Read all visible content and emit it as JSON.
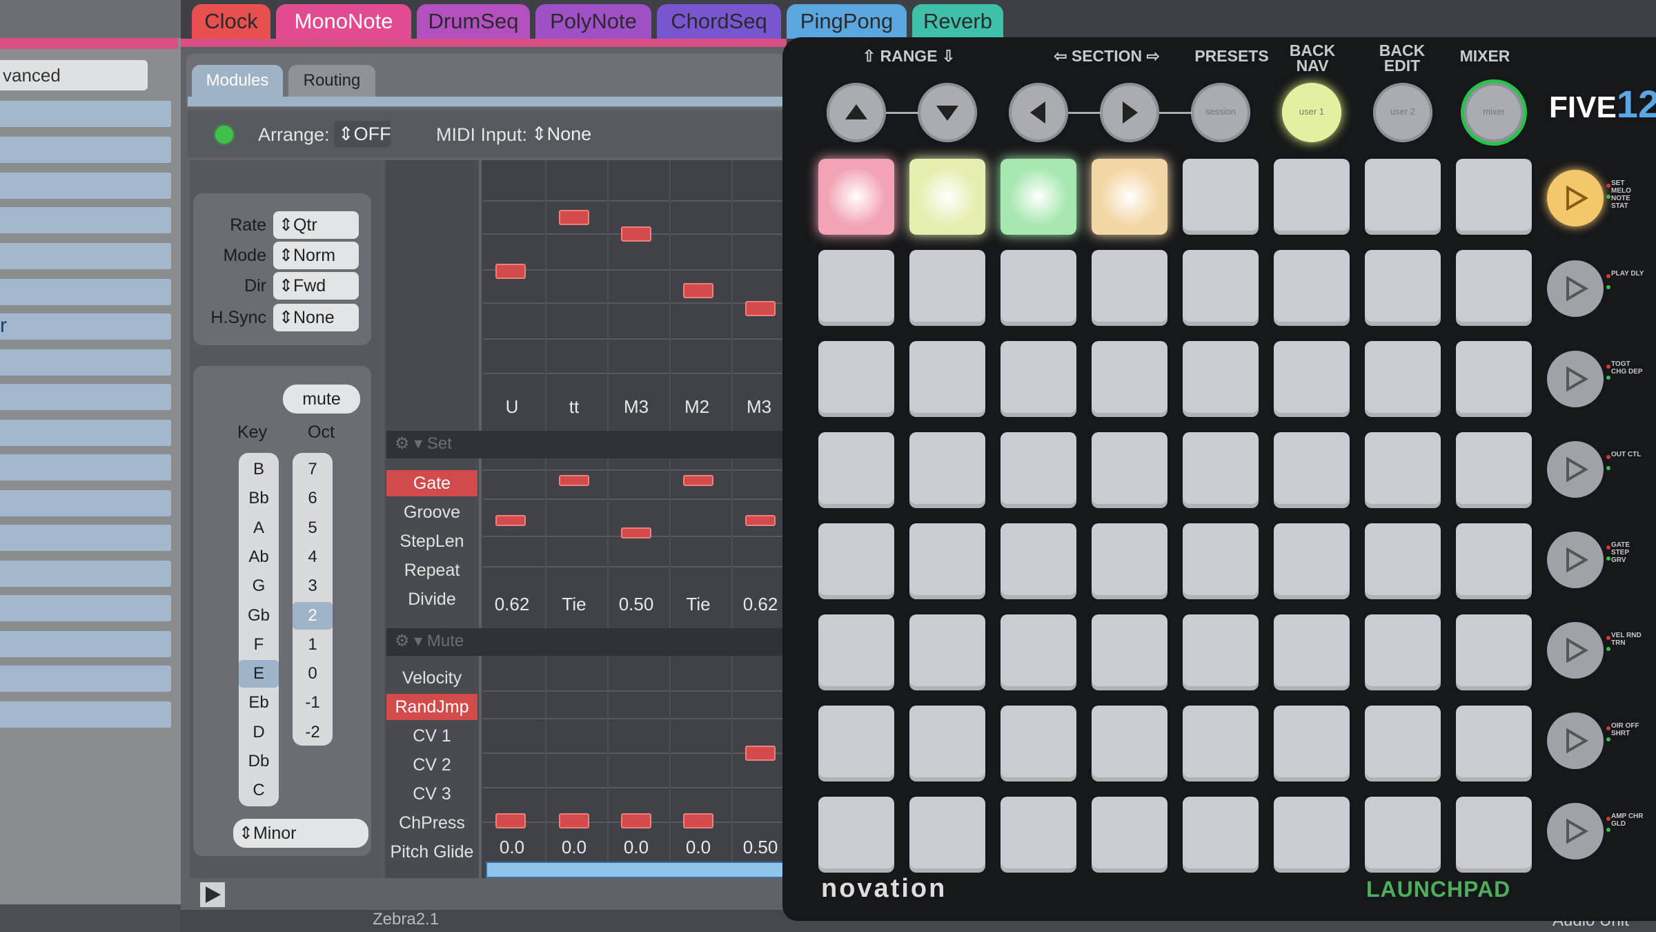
{
  "left_panel": {
    "search_value": "vanced",
    "row_text": "r"
  },
  "tabs": [
    {
      "label": "Clock",
      "color": "#e85050"
    },
    {
      "label": "MonoNote",
      "color": "#e24b8f"
    },
    {
      "label": "DrumSeq",
      "color": "#b44fc0"
    },
    {
      "label": "PolyNote",
      "color": "#a050c6"
    },
    {
      "label": "ChordSeq",
      "color": "#7856d0"
    },
    {
      "label": "PingPong",
      "color": "#5aa7e0"
    },
    {
      "label": "Reverb",
      "color": "#3fc0a8"
    }
  ],
  "subtabs": {
    "modules": "Modules",
    "routing": "Routing"
  },
  "header": {
    "arrange_label": "Arrange:",
    "arrange_value": "⇕OFF",
    "midi_label": "MIDI Input:",
    "midi_value": "⇕None"
  },
  "params": [
    {
      "label": "Rate",
      "value": "⇕Qtr"
    },
    {
      "label": "Mode",
      "value": "⇕Norm"
    },
    {
      "label": "Dir",
      "value": "⇕Fwd"
    },
    {
      "label": "H.Sync",
      "value": "⇕None"
    }
  ],
  "mute_label": "mute",
  "key_header": "Key",
  "oct_header": "Oct",
  "keys": [
    "B",
    "Bb",
    "A",
    "Ab",
    "G",
    "Gb",
    "F",
    "E",
    "Eb",
    "D",
    "Db",
    "C"
  ],
  "selected_key": "E",
  "octaves": [
    "7",
    "6",
    "5",
    "4",
    "3",
    "2",
    "1",
    "0",
    "-1",
    "-2"
  ],
  "selected_octave": "2",
  "scale_value": "⇕Minor",
  "intervals": [
    "U",
    "tt",
    "M3",
    "M2",
    "M3"
  ],
  "set_label": "Set",
  "mute_row_label": "Mute",
  "gate_lanes": [
    {
      "label": "Gate",
      "active": true
    },
    {
      "label": "Groove",
      "active": false
    },
    {
      "label": "StepLen",
      "active": false
    },
    {
      "label": "Repeat",
      "active": false
    },
    {
      "label": "Divide",
      "active": false
    }
  ],
  "gate_values": [
    "0.62",
    "Tie",
    "0.50",
    "Tie",
    "0.62"
  ],
  "cv_lanes": [
    {
      "label": "Velocity",
      "active": false
    },
    {
      "label": "RandJmp",
      "active": true
    },
    {
      "label": "CV 1",
      "active": false
    },
    {
      "label": "CV 2",
      "active": false
    },
    {
      "label": "CV 3",
      "active": false
    },
    {
      "label": "ChPress",
      "active": false
    },
    {
      "label": "Pitch Glide",
      "active": false
    }
  ],
  "cv_values": [
    "0.0",
    "0.0",
    "0.0",
    "0.0",
    "0.50"
  ],
  "status": {
    "left": "Zebra2.1",
    "right": "Audio Unit"
  },
  "launchpad": {
    "top_labels": {
      "range": "RANGE",
      "section": "SECTION",
      "presets": "PRESETS",
      "back_nav": "BACK NAV",
      "back_edit": "BACK EDIT",
      "mixer": "MIXER"
    },
    "round_buttons": [
      "up-arrow",
      "down-arrow",
      "left-arrow",
      "right-arrow",
      "session",
      "user 1",
      "user 2",
      "mixer"
    ],
    "round_button_text": {
      "session": "session",
      "user1": "user 1",
      "user2": "user 2",
      "mixer": "mixer"
    },
    "brand": "novation",
    "model": "LAUNCHPAD",
    "logo_five": "FIVE",
    "logo_num": "12",
    "lit_pads": [
      {
        "row": 0,
        "col": 0,
        "color": "#f2a3b5"
      },
      {
        "row": 0,
        "col": 1,
        "color": "#e6eeb0"
      },
      {
        "row": 0,
        "col": 2,
        "color": "#a6e8b0"
      },
      {
        "row": 0,
        "col": 3,
        "color": "#f3d6a5"
      }
    ],
    "active_side_color": "#f4c76a",
    "side_labels": [
      "SET MELO NOTE STAT",
      "PLAY DLY",
      "TOGT CHG DEP",
      "OUT CTL",
      "GATE STEP GRV",
      "VEL RND TRN",
      "OIR OFF SHRT",
      "AMP CHR GLD"
    ]
  }
}
